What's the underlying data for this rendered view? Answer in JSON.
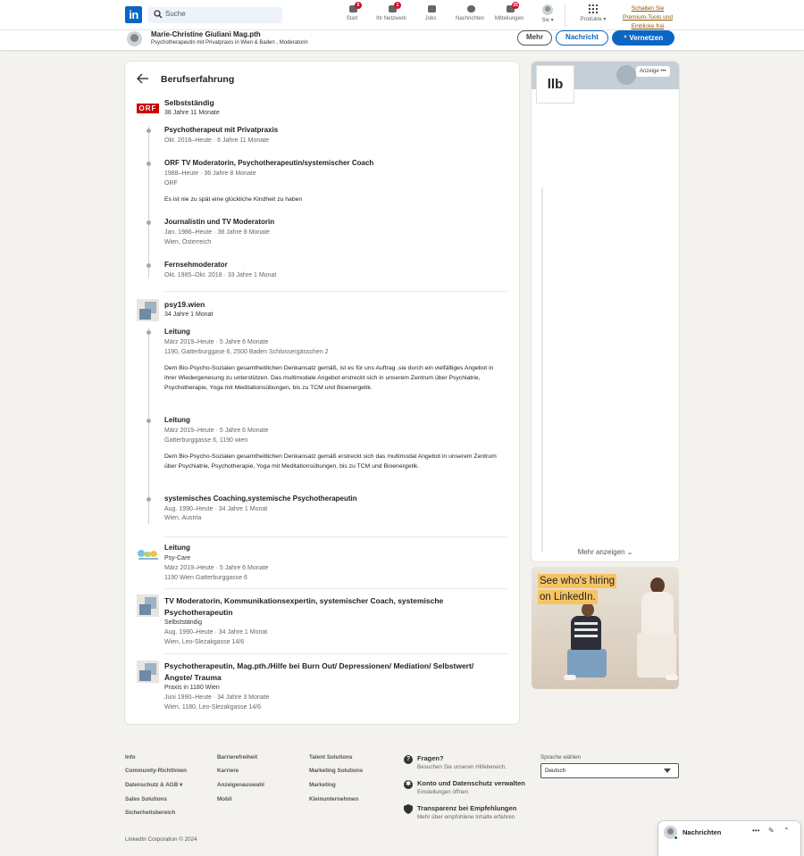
{
  "nav": {
    "search_placeholder": "Suche",
    "items": [
      {
        "label": "Start",
        "badge": "5"
      },
      {
        "label": "Ihr Netzwerk",
        "badge": "1"
      },
      {
        "label": "Jobs",
        "badge": ""
      },
      {
        "label": "Nachrichten",
        "badge": ""
      },
      {
        "label": "Mitteilungen",
        "badge": "25"
      },
      {
        "label": "Sie ▾",
        "badge": ""
      },
      {
        "label": "Produkte ▾",
        "badge": ""
      }
    ],
    "premium_line1": "Schalten Sie",
    "premium_line2": "Premium-Tools und",
    "premium_line3": "Einblicke frei"
  },
  "profile": {
    "name": "Marie-Christine Giuliani Mag.pth",
    "headline": "Psychotherapeutin mit Privatpraxis in Wien & Baden , Moderatorin",
    "btn_more": "Mehr",
    "btn_message": "Nachricht",
    "btn_connect": "Vernetzen"
  },
  "experience": {
    "title": "Berufserfahrung",
    "orf": {
      "logo_text": "ORF",
      "company": "Selbstständig",
      "duration": "38 Jahre 11 Monate",
      "roles": [
        {
          "title": "Psychotherapeut mit Privatpraxis",
          "dates": "Okt. 2018–Heute · 6 Jahre 11 Monate"
        },
        {
          "title": "ORF TV Moderatorin, Psychotherapeutin/systemischer Coach",
          "dates": "1988–Heute · 36 Jahre 8 Monate",
          "place": "ORF",
          "desc": "Es ist nie zu spät eine glückliche Kindheit zu haben"
        },
        {
          "title": "Journalistin und TV Moderatorin",
          "dates": "Jan. 1986–Heute · 38 Jahre 8 Monate",
          "place": "Wien, Österreich"
        },
        {
          "title": "Fernsehmoderator",
          "dates": "Okt. 1985–Okt. 2018 · 33 Jahre 1 Monat"
        }
      ]
    },
    "psy19": {
      "company": "psy19.wien",
      "duration": "34 Jahre 1 Monat",
      "roles": [
        {
          "title": "Leitung",
          "dates": "März 2019–Heute · 5 Jahre 6 Monate",
          "place": "1190, Gatterburggase 6, 2500 Baden Schlossergässchen 2",
          "desc": "Dem Bio-Psycho-Sozialen gesamtheitlichen Denkansatz gemäß, ist es für uns Auftrag ,sie durch ein vielfältiges Angebot in ihrer Wiedergenesung zu unterstützen. Das multimodale Angebot erstreckt sich in unserem Zentrum über Psychiatrie, Psychotherapie, Yoga mit Meditationsübungen, bis zu TCM und Bioenergetik."
        },
        {
          "title": "Leitung",
          "dates": "März 2019–Heute · 5 Jahre 6 Monate",
          "place": "Gatterburggasse 6, 1190 wien",
          "desc": "Dem Bio-Psycho-Sozialen gesamtheitlichen Denkansatz gemäß erstreckt sich das multimodal Angebot in unserem Zentrum über Psychiatrie, Psychotherapie, Yoga mit Meditationsübungen, bis zu TCM und Bioenergetik."
        },
        {
          "title": "systemisches Coaching,systemische Psychotherapeutin",
          "dates": "Aug. 1990–Heute · 34 Jahre 1 Monat",
          "place": "Wien, Austria"
        }
      ]
    },
    "singles": [
      {
        "title": "Leitung",
        "company": "Psy-Care",
        "dates": "März 2019–Heute · 5 Jahre 6 Monate",
        "place": "1190 Wien Gatterburggasse 6"
      },
      {
        "title": "TV Moderatorin, Kommunikationsexpertin, systemischer Coach, systemische Psychotherapeutin",
        "company": "Selbstständig",
        "dates": "Aug. 1990–Heute · 34 Jahre 1 Monat",
        "place": "Wien, Leo-Slezakgasse 14/6"
      },
      {
        "title": "Psychotherapeutin, Mag.pth./Hilfe bei Burn Out/ Depressionen/ Mediation/ Selbstwert/ Ängste/ Trauma",
        "company": "Praxis in 1180 Wien",
        "dates": "Juni 1990–Heute · 34 Jahre 3 Monate",
        "place": "Wien, 1180, Leo-Slezakgasse 14/6"
      }
    ]
  },
  "sidebar": {
    "ad_label": "Anzeige",
    "ad_logo_text": "llb",
    "show_more": "Mehr anzeigen",
    "hiring_line1": "See who's hiring",
    "hiring_line2": "on LinkedIn."
  },
  "footer": {
    "col1": [
      "Info",
      "Community-Richtlinien",
      "Datenschutz & AGB ▾",
      "Sales Solutions",
      "Sicherheitsbereich"
    ],
    "col2": [
      "Barrierefreiheit",
      "Karriere",
      "Anzeigenauswahl",
      "Mobil"
    ],
    "col3": [
      "Talent Solutions",
      "Marketing Solutions",
      "Marketing",
      "Kleinunternehmen"
    ],
    "help": [
      {
        "title": "Fragen?",
        "sub": "Besuchen Sie unseren Hilfebereich."
      },
      {
        "title": "Konto und Datenschutz verwalten",
        "sub": "Einstellungen öffnen"
      },
      {
        "title": "Transparenz bei Empfehlungen",
        "sub": "Mehr über empfohlene Inhalte erfahren"
      }
    ],
    "lang_label": "Sprache wählen",
    "lang_value": "Deutsch",
    "copyright": "LinkedIn Corporation © 2024"
  },
  "messaging": {
    "title": "Nachrichten"
  }
}
